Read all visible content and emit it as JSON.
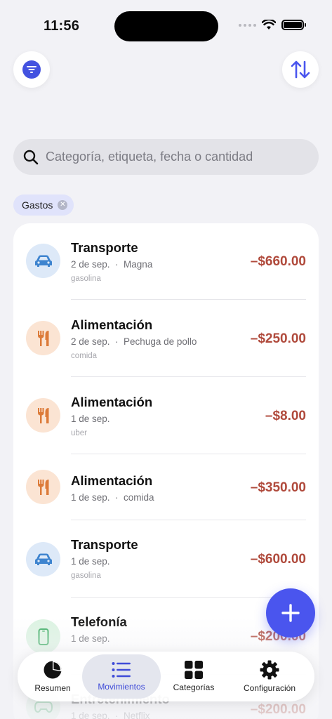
{
  "status_bar": {
    "time": "11:56"
  },
  "search": {
    "placeholder": "Categoría, etiqueta, fecha o cantidad"
  },
  "filter_chip": {
    "label": "Gastos"
  },
  "transactions": [
    {
      "category": "Transporte",
      "date": "2 de sep.",
      "note": "Magna",
      "tag": "gasolina",
      "amount": "–$660.00",
      "icon": "car-icon"
    },
    {
      "category": "Alimentación",
      "date": "2 de sep.",
      "note": "Pechuga de pollo",
      "tag": "comida",
      "amount": "–$250.00",
      "icon": "fork-knife-icon"
    },
    {
      "category": "Alimentación",
      "date": "1 de sep.",
      "note": "",
      "tag": "uber",
      "amount": "–$8.00",
      "icon": "fork-knife-icon"
    },
    {
      "category": "Alimentación",
      "date": "1 de sep.",
      "note": "comida",
      "tag": "",
      "amount": "–$350.00",
      "icon": "fork-knife-icon"
    },
    {
      "category": "Transporte",
      "date": "1 de sep.",
      "note": "",
      "tag": "gasolina",
      "amount": "–$600.00",
      "icon": "car-icon"
    },
    {
      "category": "Telefonía",
      "date": "1 de sep.",
      "note": "",
      "tag": "",
      "amount": "–$200.00",
      "icon": "phone-icon"
    },
    {
      "category": "Entretenimiento",
      "date": "1 de sep.",
      "note": "Netflix",
      "tag": "",
      "amount": "–$200.00",
      "icon": "gamepad-icon"
    }
  ],
  "tabs": [
    {
      "label": "Resumen",
      "icon": "pie-chart-icon",
      "active": false
    },
    {
      "label": "Movimientos",
      "icon": "list-icon",
      "active": true
    },
    {
      "label": "Categorías",
      "icon": "grid-icon",
      "active": false
    },
    {
      "label": "Configuración",
      "icon": "gear-icon",
      "active": false
    }
  ],
  "colors": {
    "accent": "#4a55ee",
    "expense": "#b04a3c",
    "transport_bg": "#dde9f8",
    "transport_fg": "#3e84cf",
    "food_bg": "#fbe4d3",
    "food_fg": "#dc7a38",
    "phone_bg": "#dcf3e2",
    "phone_fg": "#3fae65"
  }
}
